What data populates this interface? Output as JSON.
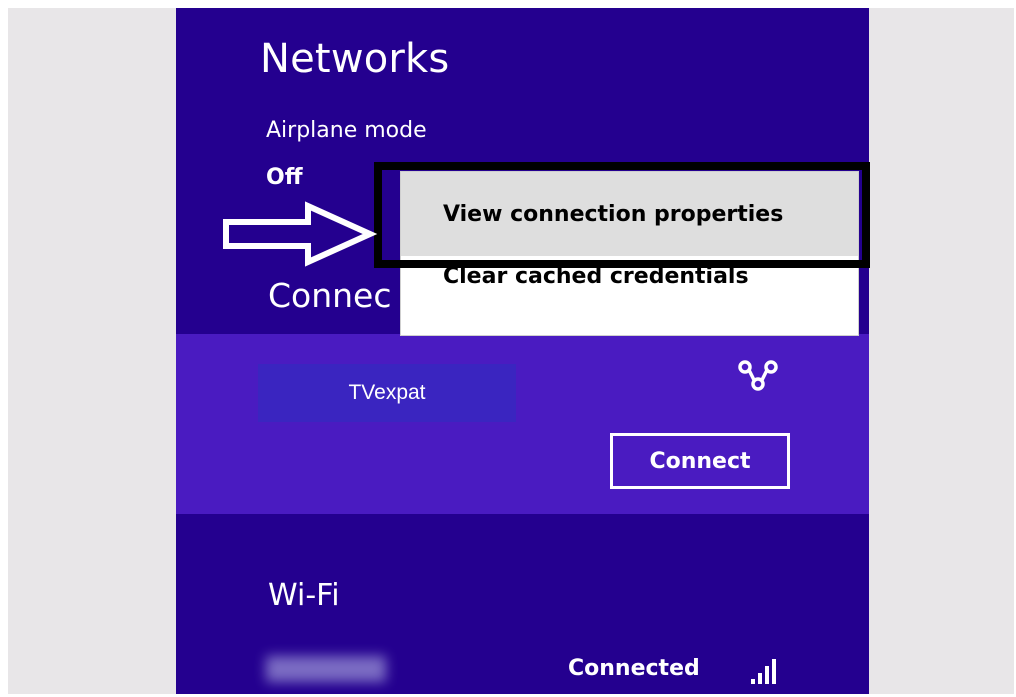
{
  "panel": {
    "title": "Networks",
    "airplane_mode": {
      "label": "Airplane mode",
      "value": "Off"
    },
    "section_heading": "Connec"
  },
  "network": {
    "name": "TVexpat",
    "icon": "network-link-icon",
    "connect_label": "Connect"
  },
  "wifi": {
    "heading": "Wi-Fi",
    "status": "Connected",
    "signal_icon": "signal-bars-icon"
  },
  "context_menu": {
    "items": [
      {
        "label": "View connection properties",
        "highlighted": true
      },
      {
        "label": "Clear cached credentials",
        "highlighted": false
      }
    ]
  },
  "annotation": {
    "arrow_icon": "arrow-right-icon"
  },
  "colors": {
    "panel_bg": "#24008f",
    "row_bg": "#4a1bc1",
    "name_box_bg": "#3a25c0",
    "menu_highlight": "#dedede",
    "frame": "#000000"
  }
}
